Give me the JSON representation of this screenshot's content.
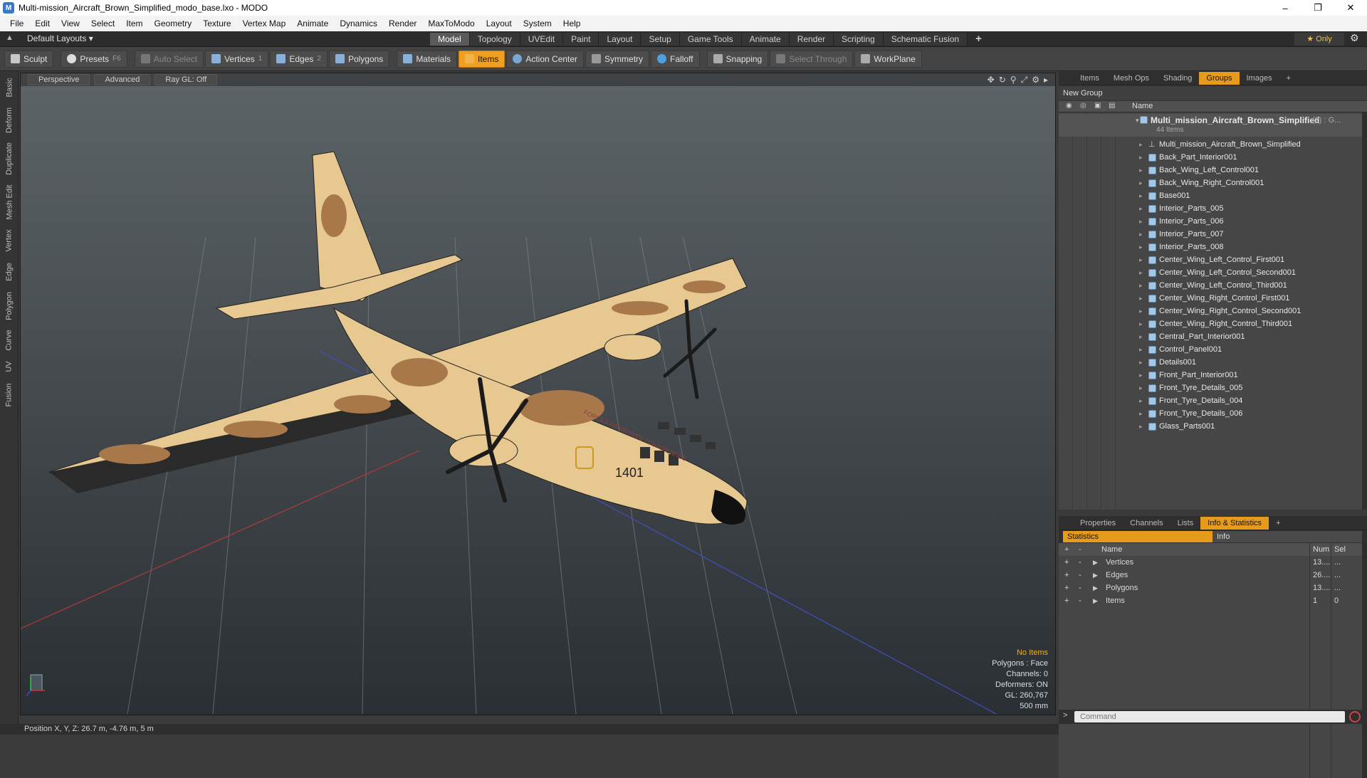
{
  "window": {
    "title": "Multi-mission_Aircraft_Brown_Simplified_modo_base.lxo - MODO",
    "minimize": "–",
    "maximize": "❐",
    "close": "✕"
  },
  "menu": [
    "File",
    "Edit",
    "View",
    "Select",
    "Item",
    "Geometry",
    "Texture",
    "Vertex Map",
    "Animate",
    "Dynamics",
    "Render",
    "MaxToModo",
    "Layout",
    "System",
    "Help"
  ],
  "layout_bar": {
    "layout_selector": "Default Layouts ▾",
    "tabs": [
      "Model",
      "Topology",
      "UVEdit",
      "Paint",
      "Layout",
      "Setup",
      "Game Tools",
      "Animate",
      "Render",
      "Scripting",
      "Schematic Fusion"
    ],
    "active_tab": "Model",
    "add": "+",
    "only_label": "★  Only",
    "gear": "⚙"
  },
  "toolbar": {
    "sculpt": "Sculpt",
    "presets": "Presets",
    "presets_key": "F6",
    "auto_select": "Auto Select",
    "vertices": "Vertices",
    "vertices_key": "1",
    "edges": "Edges",
    "edges_key": "2",
    "polygons": "Polygons",
    "materials": "Materials",
    "items": "Items",
    "action_center": "Action Center",
    "symmetry": "Symmetry",
    "falloff": "Falloff",
    "snapping": "Snapping",
    "select_through": "Select Through",
    "workplane": "WorkPlane"
  },
  "left_tabs": [
    "Basic",
    "Deform",
    "Duplicate",
    "Mesh Edit",
    "Vertex",
    "Edge",
    "Polygon",
    "Curve",
    "UV",
    "Fusion"
  ],
  "viewport": {
    "view": "Perspective",
    "shading": "Advanced",
    "raygl": "Ray GL: Off",
    "info": {
      "no_items": "No Items",
      "polygons": "Polygons : Face",
      "channels": "Channels: 0",
      "deformers": "Deformers: ON",
      "gl": "GL: 260,767",
      "scale": "500 mm"
    },
    "aircraft_text": {
      "tail_number": "1401",
      "roundel": "FORCES AERIENNES TCHADIENNES"
    }
  },
  "status": {
    "position": "Position X, Y, Z:   26.7 m, -4.76 m, 5 m"
  },
  "top_panel": {
    "tabs": [
      "Items",
      "Mesh Ops",
      "Shading",
      "Groups",
      "Images"
    ],
    "active": "Groups",
    "add": "+",
    "new_group": "New Group",
    "col_name": "Name",
    "group": {
      "name": "Multi_mission_Aircraft_Brown_Simplified",
      "count": "(2) : G...",
      "subtitle": "44 Items"
    },
    "items": [
      "Multi_mission_Aircraft_Brown_Simplified",
      "Back_Part_Interior001",
      "Back_Wing_Left_Control001",
      "Back_Wing_Right_Control001",
      "Base001",
      "Interior_Parts_005",
      "Interior_Parts_006",
      "Interior_Parts_007",
      "Interior_Parts_008",
      "Center_Wing_Left_Control_First001",
      "Center_Wing_Left_Control_Second001",
      "Center_Wing_Left_Control_Third001",
      "Center_Wing_Right_Control_First001",
      "Center_Wing_Right_Control_Second001",
      "Center_Wing_Right_Control_Third001",
      "Central_Part_Interior001",
      "Control_Panel001",
      "Details001",
      "Front_Part_Interior001",
      "Front_Tyre_Details_005",
      "Front_Tyre_Details_004",
      "Front_Tyre_Details_006",
      "Glass_Parts001"
    ]
  },
  "bottom_panel": {
    "tabs": [
      "Properties",
      "Channels",
      "Lists",
      "Info & Statistics"
    ],
    "active": "Info & Statistics",
    "add": "+",
    "statistics": "Statistics",
    "info": "Info",
    "columns": {
      "name": "Name",
      "num": "Num",
      "sel": "Sel"
    },
    "rows": [
      {
        "name": "Vertices",
        "num": "13....",
        "sel": "..."
      },
      {
        "name": "Edges",
        "num": "26....",
        "sel": "..."
      },
      {
        "name": "Polygons",
        "num": "13....",
        "sel": "..."
      },
      {
        "name": "Items",
        "num": "1",
        "sel": "0"
      }
    ]
  },
  "command": {
    "placeholder": "Command"
  }
}
